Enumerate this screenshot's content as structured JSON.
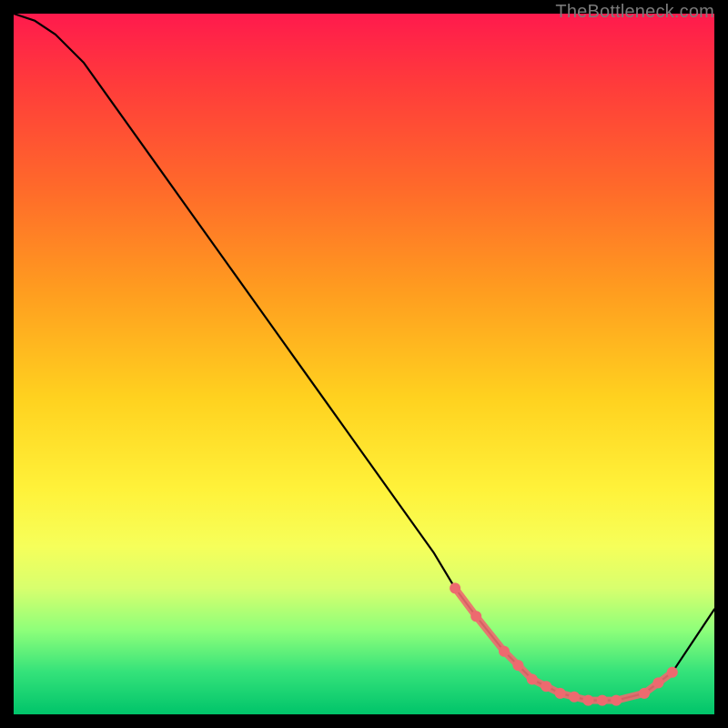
{
  "watermark": "TheBottleneck.com",
  "chart_data": {
    "type": "line",
    "title": "",
    "xlabel": "",
    "ylabel": "",
    "xlim": [
      0,
      100
    ],
    "ylim": [
      0,
      100
    ],
    "grid": false,
    "legend": false,
    "background_gradient": {
      "top": "#ff1a4d",
      "mid": "#fff23a",
      "bottom": "#00c46a"
    },
    "series": [
      {
        "name": "bottleneck-curve",
        "color": "#000000",
        "x": [
          0,
          3,
          6,
          10,
          15,
          20,
          25,
          30,
          35,
          40,
          45,
          50,
          55,
          60,
          63,
          66,
          70,
          74,
          78,
          82,
          86,
          90,
          94,
          100
        ],
        "y": [
          100,
          99,
          97,
          93,
          86,
          79,
          72,
          65,
          58,
          51,
          44,
          37,
          30,
          23,
          18,
          14,
          9,
          5,
          3,
          2,
          2,
          3,
          6,
          15
        ]
      }
    ],
    "markers": {
      "name": "highlight-dots",
      "color": "#ed6a6f",
      "shape": "circle",
      "x": [
        63,
        66,
        70,
        72,
        74,
        76,
        78,
        80,
        82,
        84,
        86,
        90,
        92,
        94
      ],
      "y": [
        18,
        14,
        9,
        7,
        5,
        4,
        3,
        2.5,
        2,
        2,
        2,
        3,
        4.5,
        6
      ]
    }
  }
}
